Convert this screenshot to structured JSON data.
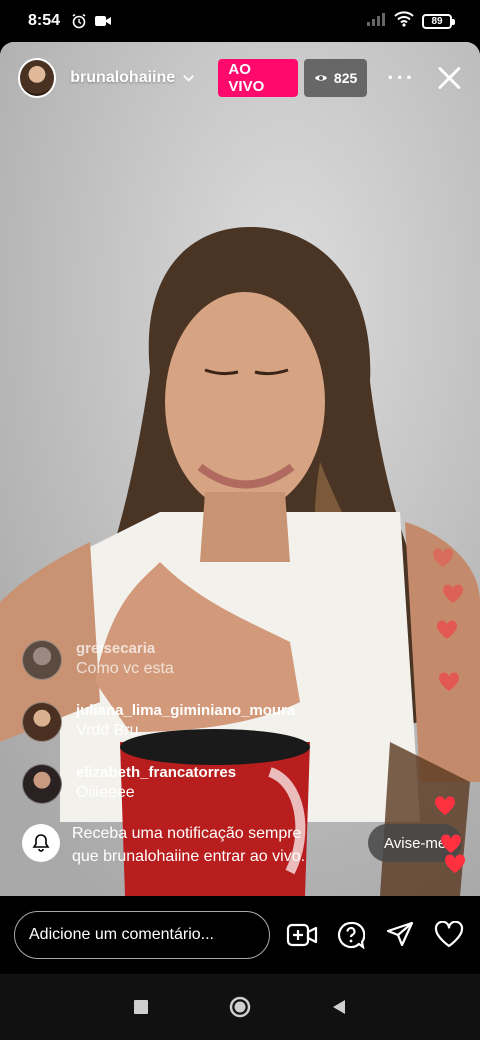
{
  "status_bar": {
    "time": "8:54",
    "battery": "89"
  },
  "header": {
    "host_name": "brunalohaiine",
    "live_label": "AO VIVO",
    "viewer_count": "825"
  },
  "comments": [
    {
      "user": "greisecaria",
      "text": "Como vc esta",
      "avatar_color": "#3a3a3a"
    },
    {
      "user": "juliana_lima_giminiano_moura",
      "text": "Vrdd Bru",
      "avatar_color": "#5a4030"
    },
    {
      "user": "elizabeth_francatorres",
      "text": "Oiiieeee",
      "avatar_color": "#2a2a2a"
    }
  ],
  "notification": {
    "text_line1": "Receba uma notificação sempre",
    "text_line2": "que brunalohaiine entrar ao vivo.",
    "button_label": "Avise-me"
  },
  "comment_bar": {
    "placeholder": "Adicione um comentário..."
  },
  "colors": {
    "live_badge": "#ff0a6c",
    "heart": "#ff3040"
  },
  "icons": [
    "alarm-icon",
    "camera-icon",
    "signal-icon",
    "wifi-icon",
    "battery-icon",
    "eye-icon",
    "more-icon",
    "close-icon",
    "bell-icon",
    "add-video-icon",
    "question-icon",
    "send-icon",
    "heart-icon",
    "square-nav-icon",
    "circle-nav-icon",
    "triangle-nav-icon"
  ]
}
